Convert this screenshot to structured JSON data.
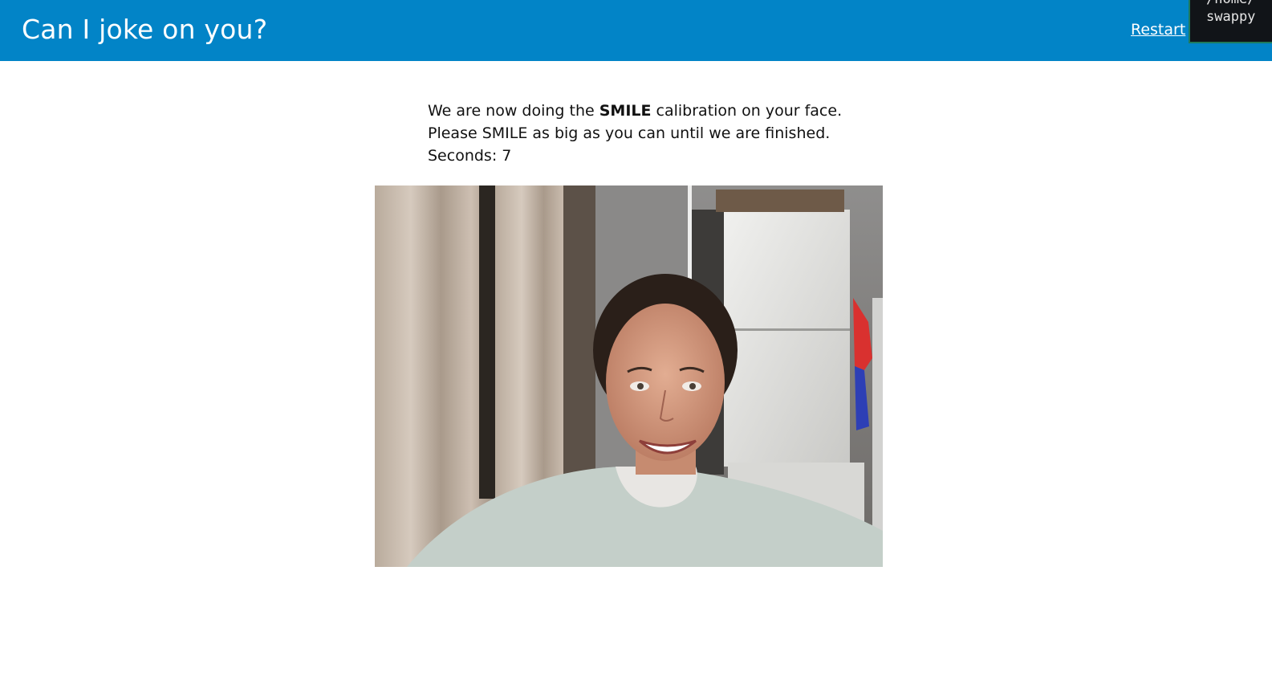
{
  "header": {
    "title": "Can I joke on you?",
    "restart_label": "Restart",
    "background_color": "#0284c7"
  },
  "terminal_overlay": {
    "line1": "/home/",
    "line2": "swappy"
  },
  "calibration": {
    "line1_prefix": "We are now doing the ",
    "line1_emphasis": "SMILE",
    "line1_suffix": " calibration on your face.",
    "line2": "Please SMILE as big as you can until we are finished.",
    "seconds_label": "Seconds:",
    "seconds_value": "7"
  },
  "webcam": {
    "description_icon": "webcam-feed"
  }
}
